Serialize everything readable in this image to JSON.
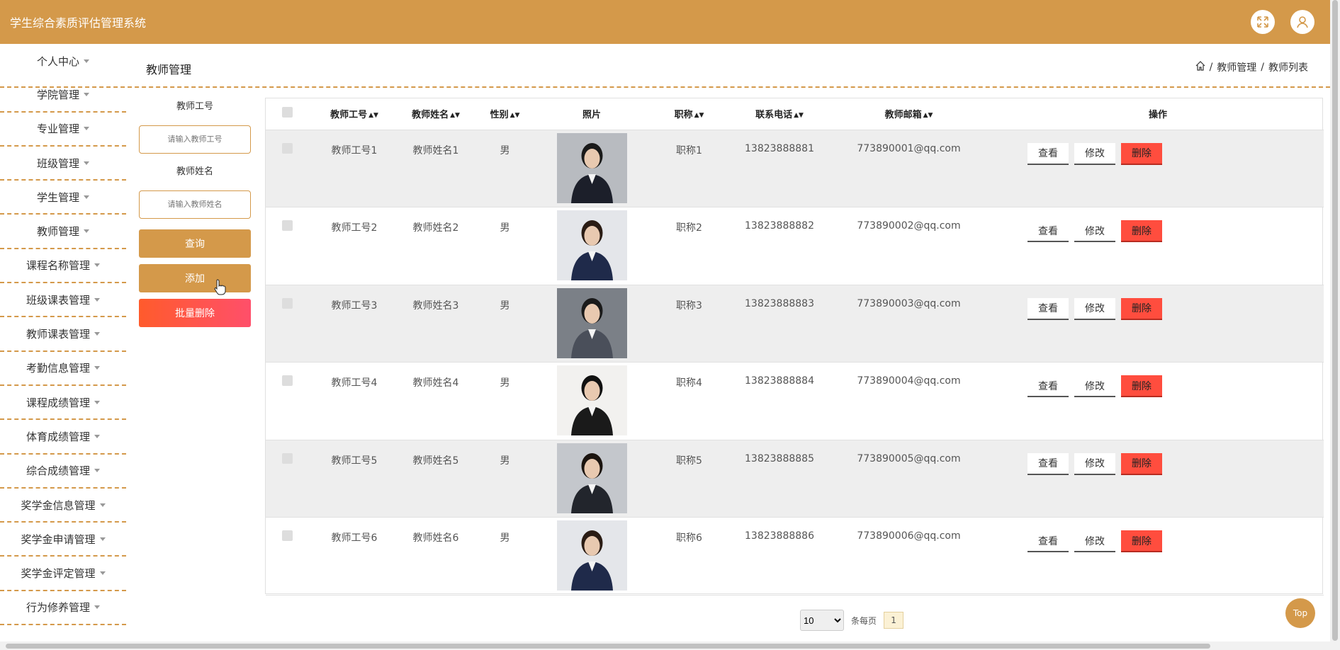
{
  "app": {
    "title": "学生综合素质评估管理系统"
  },
  "header": {
    "fullscreen_icon": "expand-icon",
    "user_icon": "user-icon"
  },
  "sidebar": {
    "items": [
      {
        "label": "个人中心"
      },
      {
        "label": "学院管理"
      },
      {
        "label": "专业管理"
      },
      {
        "label": "班级管理"
      },
      {
        "label": "学生管理"
      },
      {
        "label": "教师管理"
      },
      {
        "label": "课程名称管理"
      },
      {
        "label": "班级课表管理"
      },
      {
        "label": "教师课表管理"
      },
      {
        "label": "考勤信息管理"
      },
      {
        "label": "课程成绩管理"
      },
      {
        "label": "体育成绩管理"
      },
      {
        "label": "综合成绩管理"
      },
      {
        "label": "奖学金信息管理"
      },
      {
        "label": "奖学金申请管理"
      },
      {
        "label": "奖学金评定管理"
      },
      {
        "label": "行为修养管理"
      }
    ]
  },
  "page": {
    "title": "教师管理"
  },
  "breadcrumb": {
    "items": [
      "教师管理",
      "教师列表"
    ],
    "separator": "/"
  },
  "search": {
    "label_id": "教师工号",
    "placeholder_id": "请输入教师工号",
    "label_name": "教师姓名",
    "placeholder_name": "请输入教师姓名",
    "query_label": "查询",
    "add_label": "添加",
    "batch_delete_label": "批量删除"
  },
  "table": {
    "columns": [
      "教师工号",
      "教师姓名",
      "性别",
      "照片",
      "职称",
      "联系电话",
      "教师邮箱",
      "操作"
    ],
    "rows": [
      {
        "id": "教师工号1",
        "name": "教师姓名1",
        "gender": "男",
        "title": "职称1",
        "phone": "13823888881",
        "email": "773890001@qq.com"
      },
      {
        "id": "教师工号2",
        "name": "教师姓名2",
        "gender": "男",
        "title": "职称2",
        "phone": "13823888882",
        "email": "773890002@qq.com"
      },
      {
        "id": "教师工号3",
        "name": "教师姓名3",
        "gender": "男",
        "title": "职称3",
        "phone": "13823888883",
        "email": "773890003@qq.com"
      },
      {
        "id": "教师工号4",
        "name": "教师姓名4",
        "gender": "男",
        "title": "职称4",
        "phone": "13823888884",
        "email": "773890004@qq.com"
      },
      {
        "id": "教师工号5",
        "name": "教师姓名5",
        "gender": "男",
        "title": "职称5",
        "phone": "13823888885",
        "email": "773890005@qq.com"
      },
      {
        "id": "教师工号6",
        "name": "教师姓名6",
        "gender": "男",
        "title": "职称6",
        "phone": "13823888886",
        "email": "773890006@qq.com"
      }
    ],
    "actions": {
      "view": "查看",
      "edit": "修改",
      "delete": "删除"
    }
  },
  "pagination": {
    "page_size": "10",
    "page_size_options": [
      "10"
    ],
    "per_page_label": "条每页",
    "current_page": "1"
  },
  "top_button": "Top",
  "colors": {
    "accent": "#d4994a",
    "danger": "#ff4d3e",
    "row_stripe": "#eeeeee"
  }
}
